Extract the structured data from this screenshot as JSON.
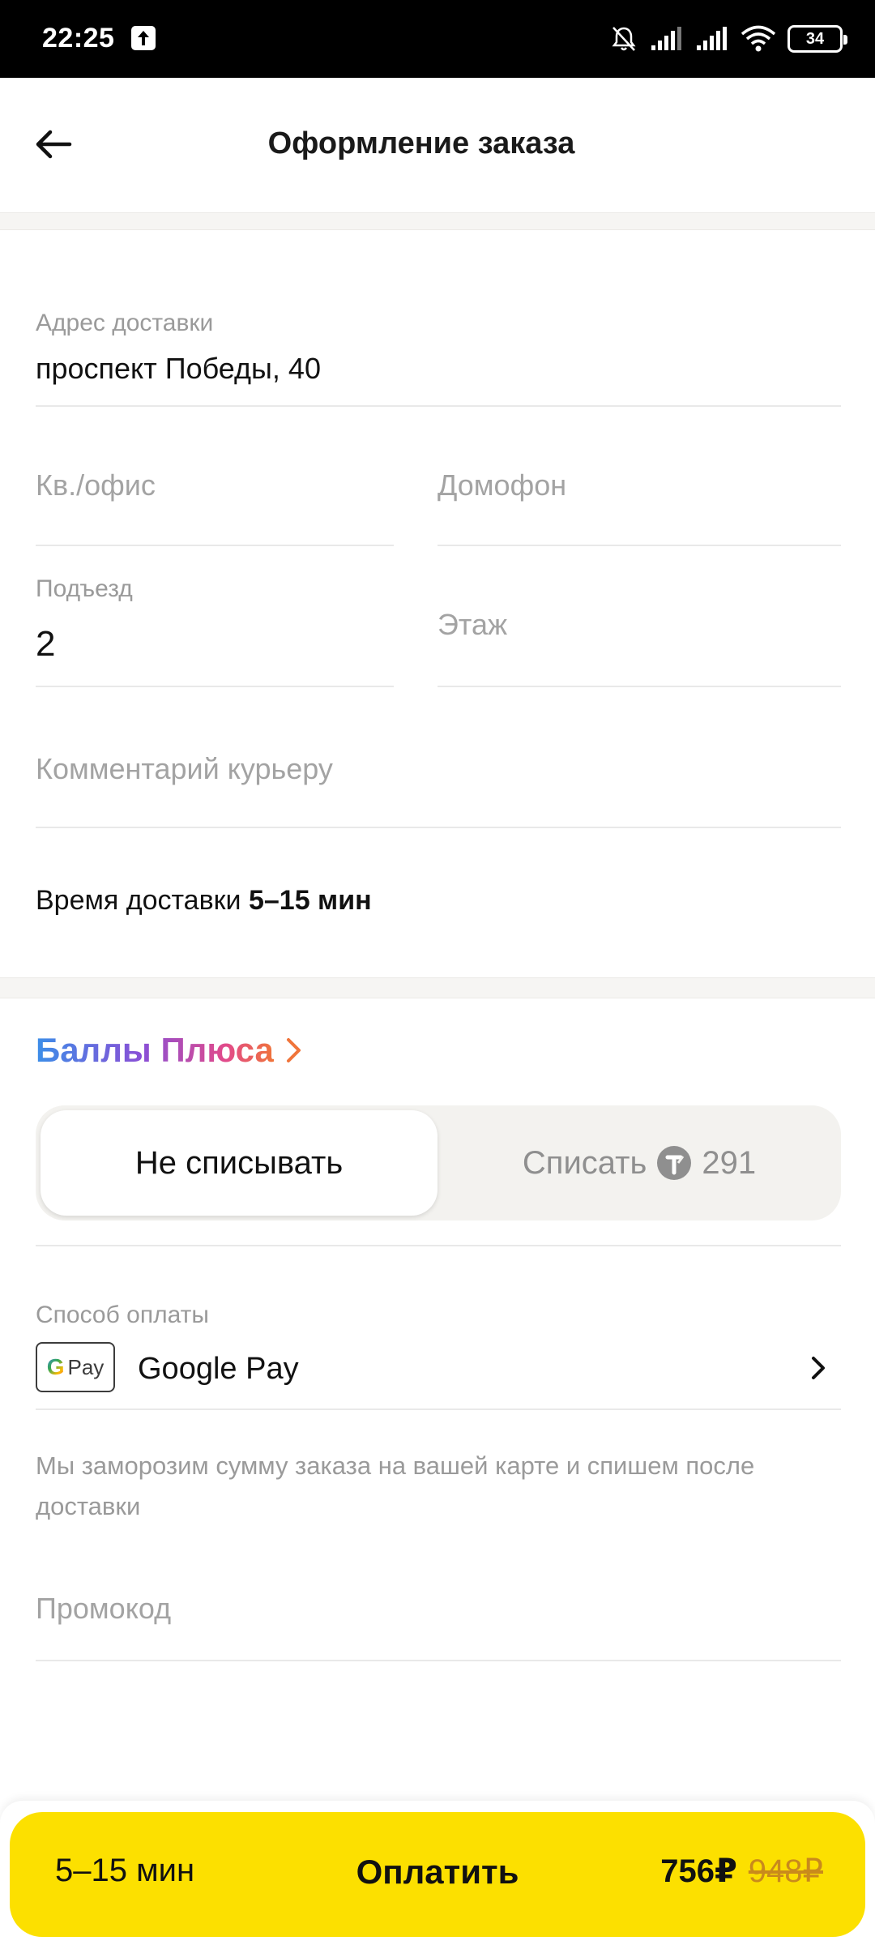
{
  "status_bar": {
    "time": "22:25",
    "battery": "34",
    "icons": [
      "upload-icon",
      "bell-off-icon",
      "signal-icon",
      "signal-icon",
      "wifi-icon",
      "battery-icon"
    ]
  },
  "header": {
    "title": "Оформление заказа",
    "back_icon": "arrow-left-icon"
  },
  "address": {
    "label": "Адрес доставки",
    "value": "проспект Победы, 40"
  },
  "apartment": {
    "placeholder": "Кв./офис"
  },
  "intercom": {
    "placeholder": "Домофон"
  },
  "entrance": {
    "label": "Подъезд",
    "value": "2"
  },
  "floor": {
    "placeholder": "Этаж"
  },
  "comment": {
    "placeholder": "Комментарий курьеру"
  },
  "delivery": {
    "prefix": "Время доставки",
    "time": "5–15 мин"
  },
  "plus": {
    "title": "Баллы Плюса",
    "options": {
      "off": "Не списывать",
      "on": "Списать",
      "points": "291"
    },
    "selected": "off"
  },
  "payment": {
    "label": "Способ оплаты",
    "badge": {
      "g": "G",
      "pay": "Pay"
    },
    "method": "Google Pay",
    "note": "Мы заморозим сумму заказа на вашей карте и спишем после доставки"
  },
  "promo": {
    "placeholder": "Промокод"
  },
  "checkout": {
    "eta": "5–15 мин",
    "cta": "Оплатить",
    "price": "756₽",
    "old_price": "948₽"
  },
  "colors": {
    "accent_yellow": "#fce000",
    "old_price": "#c98a1c"
  }
}
